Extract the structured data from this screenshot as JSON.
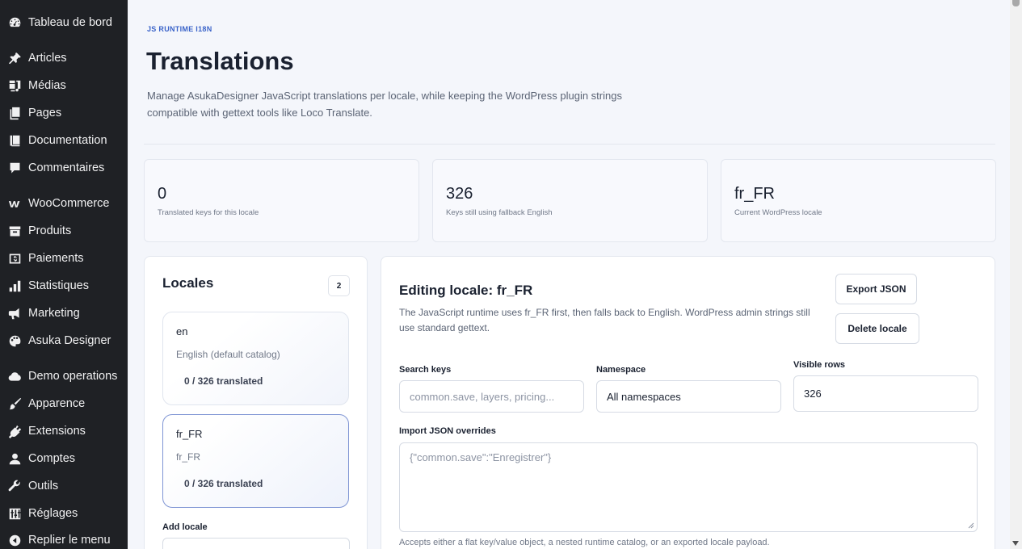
{
  "sidebar": {
    "items": [
      {
        "label": "Tableau de bord",
        "icon": "dashboard-icon"
      },
      {
        "label": "Articles",
        "icon": "pin-icon"
      },
      {
        "label": "Médias",
        "icon": "media-icon"
      },
      {
        "label": "Pages",
        "icon": "pages-icon"
      },
      {
        "label": "Documentation",
        "icon": "book-icon"
      },
      {
        "label": "Commentaires",
        "icon": "comment-icon"
      },
      {
        "label": "WooCommerce",
        "icon": "woocommerce-icon"
      },
      {
        "label": "Produits",
        "icon": "archive-icon"
      },
      {
        "label": "Paiements",
        "icon": "payment-icon"
      },
      {
        "label": "Statistiques",
        "icon": "bar-chart-icon"
      },
      {
        "label": "Marketing",
        "icon": "megaphone-icon"
      },
      {
        "label": "Asuka Designer",
        "icon": "palette-icon"
      },
      {
        "label": "Demo operations",
        "icon": "cloud-icon"
      },
      {
        "label": "Apparence",
        "icon": "brush-icon"
      },
      {
        "label": "Extensions",
        "icon": "plugin-icon"
      },
      {
        "label": "Comptes",
        "icon": "user-icon"
      },
      {
        "label": "Outils",
        "icon": "wrench-icon"
      },
      {
        "label": "Réglages",
        "icon": "settings-sliders-icon"
      },
      {
        "label": "Replier le menu",
        "icon": "collapse-icon"
      }
    ]
  },
  "header": {
    "eyebrow": "JS RUNTIME I18N",
    "title": "Translations",
    "description": "Manage AsukaDesigner JavaScript translations per locale, while keeping the WordPress plugin strings compatible with gettext tools like Loco Translate."
  },
  "stats": [
    {
      "value": "0",
      "caption": "Translated keys for this locale"
    },
    {
      "value": "326",
      "caption": "Keys still using fallback English"
    },
    {
      "value": "fr_FR",
      "caption": "Current WordPress locale"
    }
  ],
  "locales": {
    "title": "Locales",
    "count": "2",
    "items": [
      {
        "code": "en",
        "name": "English (default catalog)",
        "progress": "0 / 326 translated"
      },
      {
        "code": "fr_FR",
        "name": "fr_FR",
        "progress": "0 / 326 translated"
      }
    ],
    "add_label": "Add locale"
  },
  "editor": {
    "title": "Editing locale: fr_FR",
    "description": "The JavaScript runtime uses fr_FR first, then falls back to English. WordPress admin strings still use standard gettext.",
    "export_label": "Export JSON",
    "delete_label": "Delete locale",
    "search_label": "Search keys",
    "search_placeholder": "common.save, layers, pricing...",
    "namespace_label": "Namespace",
    "namespace_value": "All namespaces",
    "rows_label": "Visible rows",
    "rows_value": "326",
    "import_label": "Import JSON overrides",
    "import_placeholder": "{\"common.save\":\"Enregistrer\"}",
    "import_hint": "Accepts either a flat key/value object, a nested runtime catalog, or an exported locale payload."
  }
}
